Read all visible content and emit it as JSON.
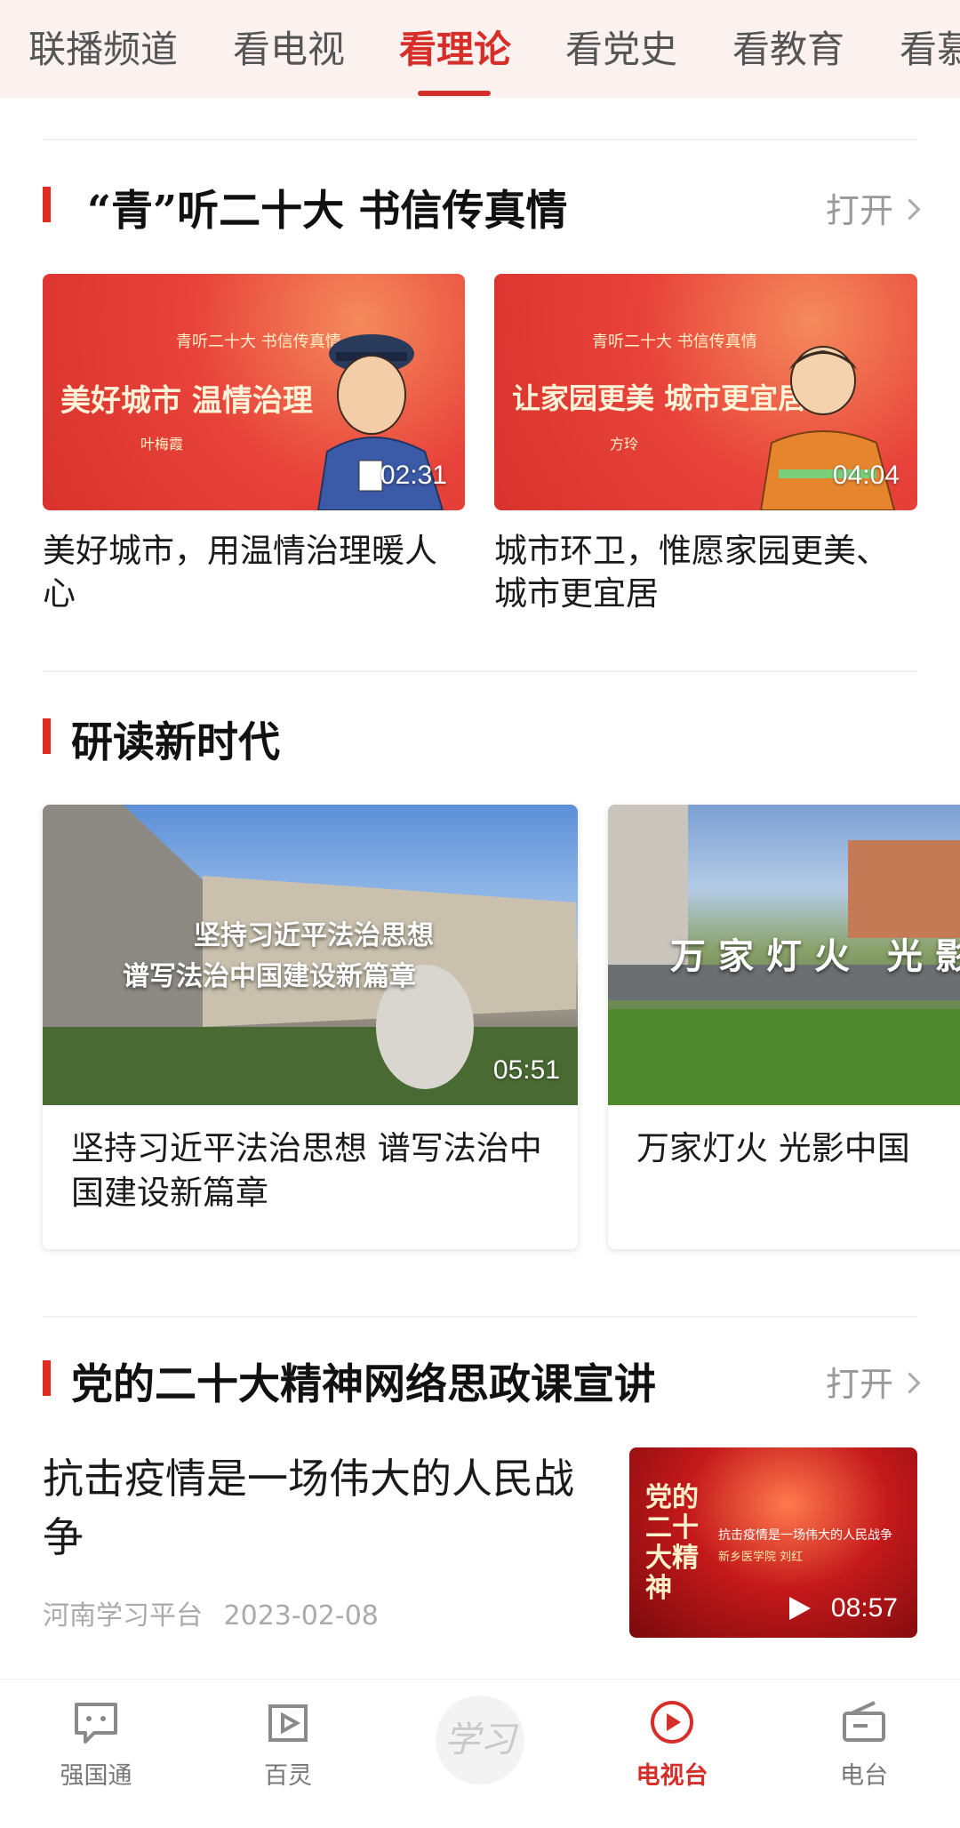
{
  "tabs": [
    "联播频道",
    "看电视",
    "看理论",
    "看党史",
    "看教育",
    "看慕"
  ],
  "active_tab": "看理论",
  "section1": {
    "title": "“青”听二十大  书信传真情",
    "open_label": "打开",
    "cards": [
      {
        "overlay": "美好城市 温情治理",
        "sub_logo": "青听二十大 书信传真情",
        "person": "叶梅霞",
        "duration": "02:31",
        "title": "美好城市，用温情治理暖人心"
      },
      {
        "overlay": "让家园更美 城市更宜居",
        "sub_logo": "青听二十大 书信传真情",
        "person": "方玲",
        "duration": "04:04",
        "title": "城市环卫，惟愿家园更美、城市更宜居"
      }
    ]
  },
  "section2": {
    "title": "研读新时代",
    "cards": [
      {
        "overlay_line1": "坚持习近平法治思想",
        "overlay_line2": "谱写法治中国建设新篇章",
        "duration": "05:51",
        "title": "坚持习近平法治思想  谱写法治中国建设新篇章"
      },
      {
        "overlay_line1": "万家灯火 光影",
        "title": "万家灯火  光影中国"
      }
    ]
  },
  "section3": {
    "title": "党的二十大精神网络思政课宣讲",
    "open_label": "打开",
    "item": {
      "title": "抗击疫情是一场伟大的人民战争",
      "source": "河南学习平台",
      "date": "2023-02-08",
      "thumb_text_big": "党的二十大精神",
      "thumb_text_small": "抗击疫情是一场伟大的人民战争",
      "thumb_text_small2": "新乡医学院 刘红",
      "duration": "08:57"
    }
  },
  "bottom_nav": [
    {
      "label": "强国通",
      "icon": "chat-icon"
    },
    {
      "label": "百灵",
      "icon": "video-bookmark-icon"
    },
    {
      "label": "学习",
      "icon": "xuexi-logo"
    },
    {
      "label": "电视台",
      "icon": "play-circle-icon",
      "active": true
    },
    {
      "label": "电台",
      "icon": "radio-icon"
    }
  ],
  "colors": {
    "accent": "#d62f2a",
    "tabbar_bg": "#fbf1ee"
  }
}
